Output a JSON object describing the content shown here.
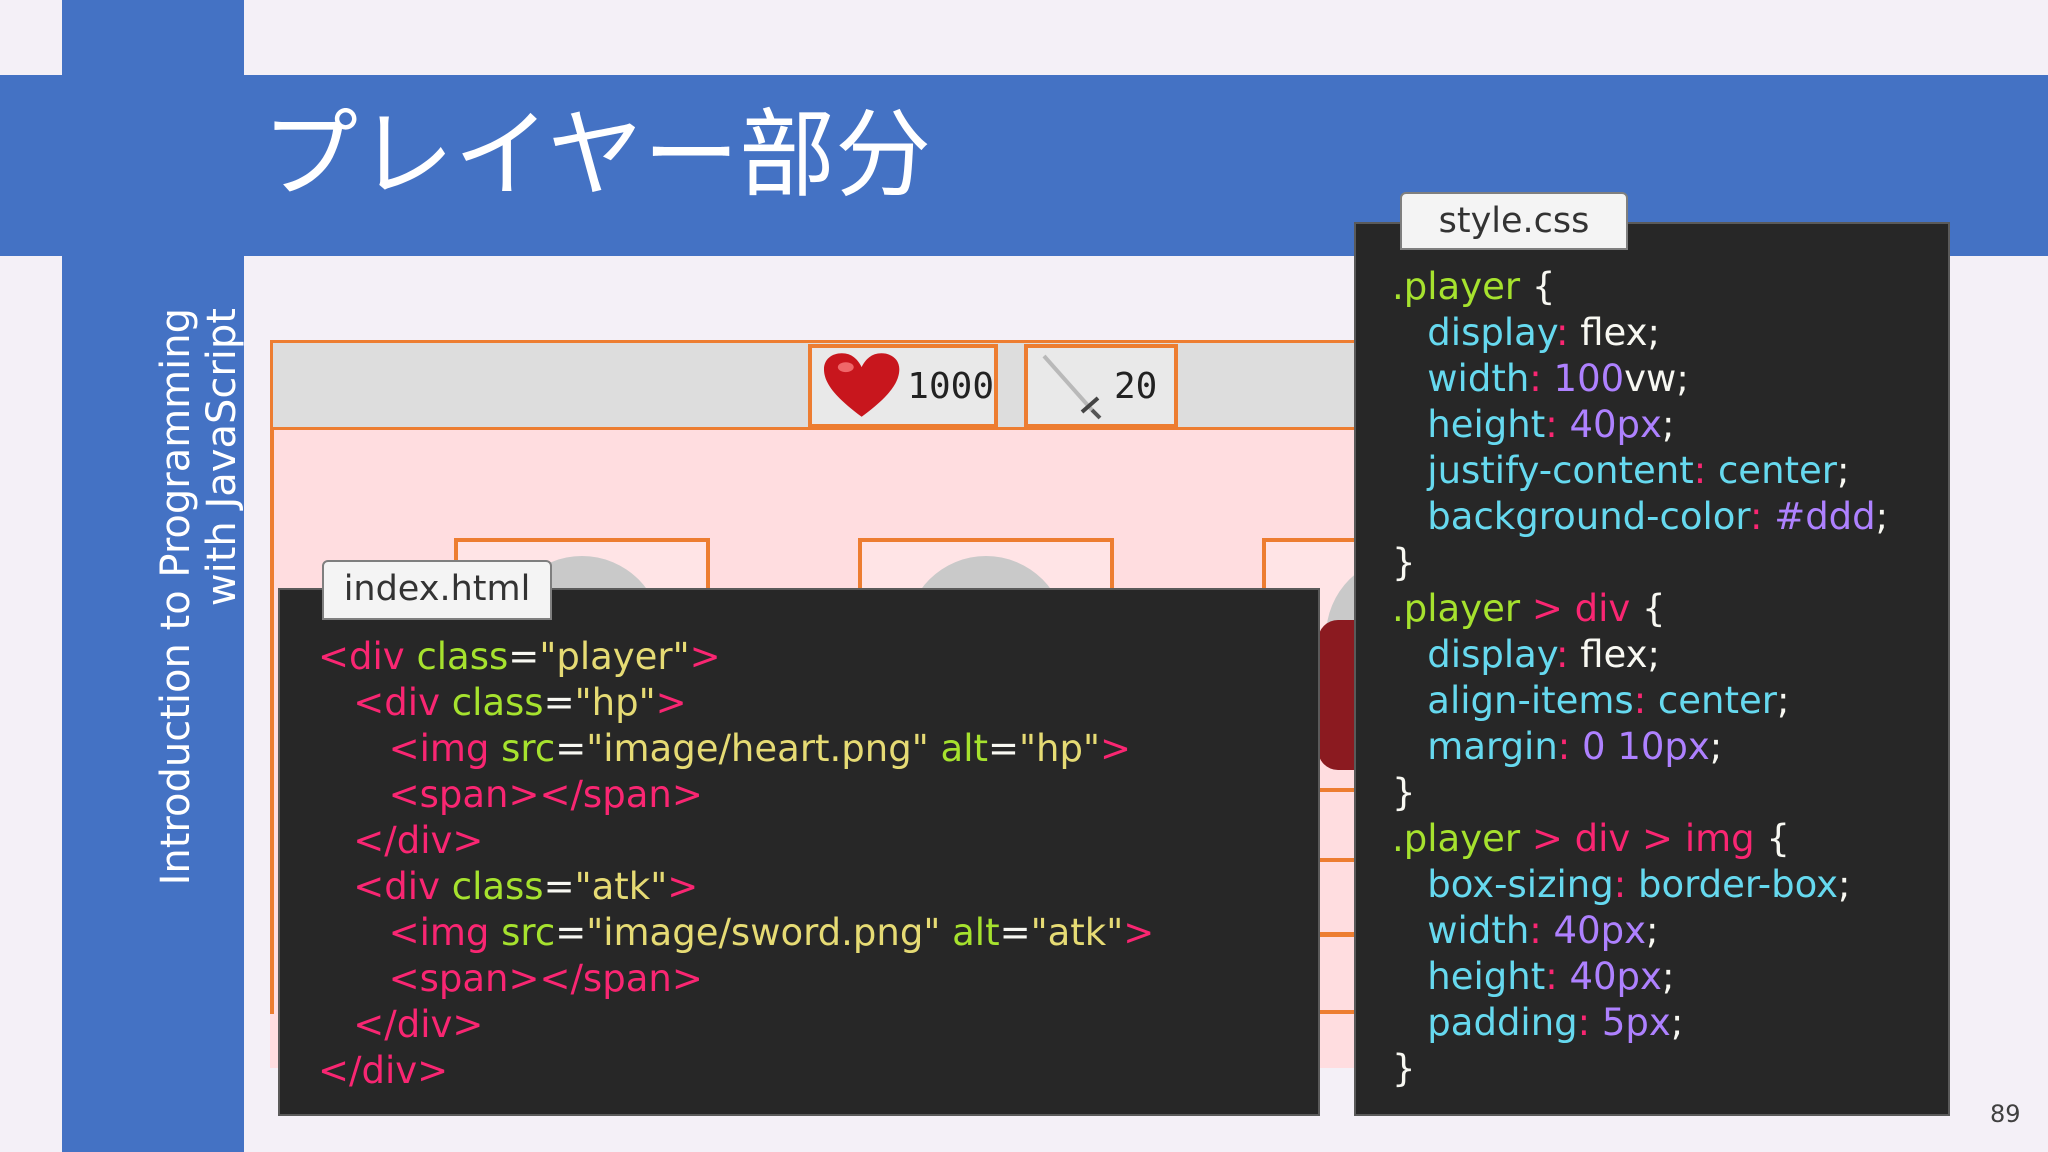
{
  "slide": {
    "title": "プレイヤー部分",
    "side_line1": "Introduction to Programming",
    "side_line2": "with JavaScript",
    "page_number": "89"
  },
  "preview": {
    "hp_value": "1000",
    "atk_value": "20"
  },
  "html_panel": {
    "tab": "index.html",
    "lines": [
      [
        [
          "t",
          "<div "
        ],
        [
          "a",
          "class"
        ],
        [
          "w",
          "="
        ],
        [
          "s",
          "\"player\""
        ],
        [
          "t",
          ">"
        ]
      ],
      [
        [
          "w",
          "   "
        ],
        [
          "t",
          "<div "
        ],
        [
          "a",
          "class"
        ],
        [
          "w",
          "="
        ],
        [
          "s",
          "\"hp\""
        ],
        [
          "t",
          ">"
        ]
      ],
      [
        [
          "w",
          "      "
        ],
        [
          "t",
          "<img "
        ],
        [
          "a",
          "src"
        ],
        [
          "w",
          "="
        ],
        [
          "s",
          "\"image/heart.png\""
        ],
        [
          "w",
          " "
        ],
        [
          "a",
          "alt"
        ],
        [
          "w",
          "="
        ],
        [
          "s",
          "\"hp\""
        ],
        [
          "t",
          ">"
        ]
      ],
      [
        [
          "w",
          "      "
        ],
        [
          "t",
          "<span></span>"
        ]
      ],
      [
        [
          "w",
          "   "
        ],
        [
          "t",
          "</div>"
        ]
      ],
      [
        [
          "w",
          "   "
        ],
        [
          "t",
          "<div "
        ],
        [
          "a",
          "class"
        ],
        [
          "w",
          "="
        ],
        [
          "s",
          "\"atk\""
        ],
        [
          "t",
          ">"
        ]
      ],
      [
        [
          "w",
          "      "
        ],
        [
          "t",
          "<img "
        ],
        [
          "a",
          "src"
        ],
        [
          "w",
          "="
        ],
        [
          "s",
          "\"image/sword.png\""
        ],
        [
          "w",
          " "
        ],
        [
          "a",
          "alt"
        ],
        [
          "w",
          "="
        ],
        [
          "s",
          "\"atk\""
        ],
        [
          "t",
          ">"
        ]
      ],
      [
        [
          "w",
          "      "
        ],
        [
          "t",
          "<span></span>"
        ]
      ],
      [
        [
          "w",
          "   "
        ],
        [
          "t",
          "</div>"
        ]
      ],
      [
        [
          "t",
          "</div>"
        ]
      ]
    ]
  },
  "css_panel": {
    "tab": "style.css",
    "lines": [
      [
        [
          "a",
          ".player"
        ],
        [
          "w",
          " {"
        ]
      ],
      [
        [
          "w",
          "   "
        ],
        [
          "p",
          "display"
        ],
        [
          "t",
          ": "
        ],
        [
          "w",
          "flex;"
        ]
      ],
      [
        [
          "w",
          "   "
        ],
        [
          "p",
          "width"
        ],
        [
          "t",
          ": "
        ],
        [
          "n",
          "100"
        ],
        [
          "w",
          "vw;"
        ]
      ],
      [
        [
          "w",
          "   "
        ],
        [
          "p",
          "height"
        ],
        [
          "t",
          ": "
        ],
        [
          "n",
          "40px"
        ],
        [
          "w",
          ";"
        ]
      ],
      [
        [
          "w",
          "   "
        ],
        [
          "p",
          "justify-content"
        ],
        [
          "t",
          ": "
        ],
        [
          "p",
          "center"
        ],
        [
          "w",
          ";"
        ]
      ],
      [
        [
          "w",
          "   "
        ],
        [
          "p",
          "background-color"
        ],
        [
          "t",
          ": "
        ],
        [
          "n",
          "#ddd"
        ],
        [
          "w",
          ";"
        ]
      ],
      [
        [
          "w",
          "}"
        ]
      ],
      [
        [
          "a",
          ".player"
        ],
        [
          "t",
          " > "
        ],
        [
          "t",
          "div"
        ],
        [
          "w",
          " {"
        ]
      ],
      [
        [
          "w",
          "   "
        ],
        [
          "p",
          "display"
        ],
        [
          "t",
          ": "
        ],
        [
          "w",
          "flex;"
        ]
      ],
      [
        [
          "w",
          "   "
        ],
        [
          "p",
          "align-items"
        ],
        [
          "t",
          ": "
        ],
        [
          "p",
          "center"
        ],
        [
          "w",
          ";"
        ]
      ],
      [
        [
          "w",
          "   "
        ],
        [
          "p",
          "margin"
        ],
        [
          "t",
          ": "
        ],
        [
          "n",
          "0 10px"
        ],
        [
          "w",
          ";"
        ]
      ],
      [
        [
          "w",
          "}"
        ]
      ],
      [
        [
          "a",
          ".player"
        ],
        [
          "t",
          " > "
        ],
        [
          "t",
          "div"
        ],
        [
          "t",
          " > "
        ],
        [
          "t",
          "img"
        ],
        [
          "w",
          " {"
        ]
      ],
      [
        [
          "w",
          "   "
        ],
        [
          "p",
          "box-sizing"
        ],
        [
          "t",
          ": "
        ],
        [
          "p",
          "border-box"
        ],
        [
          "w",
          ";"
        ]
      ],
      [
        [
          "w",
          "   "
        ],
        [
          "p",
          "width"
        ],
        [
          "t",
          ": "
        ],
        [
          "n",
          "40px"
        ],
        [
          "w",
          ";"
        ]
      ],
      [
        [
          "w",
          "   "
        ],
        [
          "p",
          "height"
        ],
        [
          "t",
          ": "
        ],
        [
          "n",
          "40px"
        ],
        [
          "w",
          ";"
        ]
      ],
      [
        [
          "w",
          "   "
        ],
        [
          "p",
          "padding"
        ],
        [
          "t",
          ": "
        ],
        [
          "n",
          "5px"
        ],
        [
          "w",
          ";"
        ]
      ],
      [
        [
          "w",
          "}"
        ]
      ]
    ]
  },
  "colors": {
    "accent": "#4472c4",
    "frame": "#ed7d31",
    "code_bg": "#272727",
    "tag": "#f92672",
    "attr": "#a6e22e",
    "string": "#e6db74",
    "property": "#66d9ef",
    "number": "#ae81ff"
  }
}
